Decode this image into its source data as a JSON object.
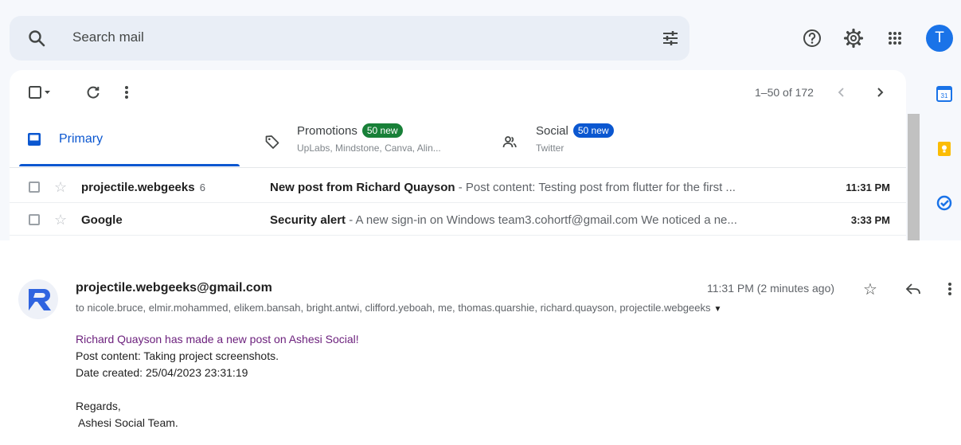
{
  "search": {
    "placeholder": "Search mail"
  },
  "header": {
    "avatar_letter": "T"
  },
  "toolbar": {
    "pager": "1–50 of 172"
  },
  "tabs": {
    "primary": {
      "label": "Primary"
    },
    "promotions": {
      "label": "Promotions",
      "badge": "50 new",
      "badge_color": "#188038",
      "sub": "UpLabs, Mindstone, Canva, Alin..."
    },
    "social": {
      "label": "Social",
      "badge": "50 new",
      "badge_color": "#0b57d0",
      "sub": "Twitter"
    }
  },
  "inbox": [
    {
      "sender": "projectile.webgeeks",
      "count": "6",
      "subject": "New post from Richard Quayson",
      "snippet": " - Post content: Testing post from flutter for the first ...",
      "time": "11:31 PM"
    },
    {
      "sender": "Google",
      "count": "",
      "subject": "Security alert",
      "snippet": " - A new sign-in on Windows team3.cohortf@gmail.com We noticed a ne...",
      "time": "3:33 PM"
    }
  ],
  "message": {
    "from": "projectile.webgeeks@gmail.com",
    "to": "to nicole.bruce, elmir.mohammed, elikem.bansah, bright.antwi, clifford.yeboah, me, thomas.quarshie, richard.quayson, projectile.webgeeks",
    "time": "11:31 PM (2 minutes ago)",
    "body": {
      "line1": "Richard Quayson has made a new post on Ashesi Social!",
      "line2": "Post content: Taking project screenshots.",
      "line3": "Date created: 25/04/2023 23:31:19",
      "regards": "Regards,",
      "signature": "Ashesi Social Team."
    }
  },
  "side_apps": {
    "calendar_day": "31"
  }
}
